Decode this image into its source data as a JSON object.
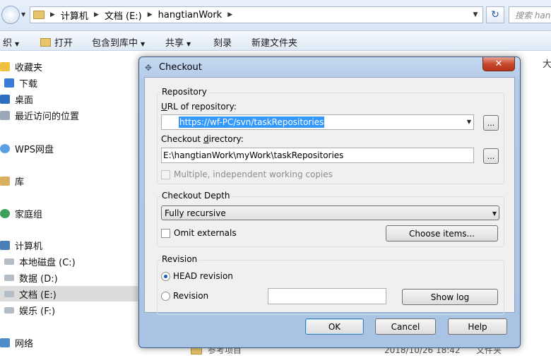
{
  "explorer": {
    "breadcrumb": [
      "计算机",
      "文档 (E:)",
      "hangtianWork"
    ],
    "search_placeholder": "搜索 hang",
    "toolbar": {
      "organize": "织",
      "open": "打开",
      "include_in_library": "包含到库中",
      "share": "共享",
      "burn": "刻录",
      "new_folder": "新建文件夹"
    },
    "sidebar": [
      {
        "label": "收藏夹",
        "icon": "star-icon"
      },
      {
        "label": "下载",
        "icon": "download-folder-icon"
      },
      {
        "label": "桌面",
        "icon": "desktop-icon"
      },
      {
        "label": "最近访问的位置",
        "icon": "recent-places-icon"
      },
      {
        "label": "WPS网盘",
        "icon": "cloud-drive-icon"
      },
      {
        "label": "库",
        "icon": "library-icon"
      },
      {
        "label": "家庭组",
        "icon": "homegroup-icon"
      },
      {
        "label": "计算机",
        "icon": "computer-icon"
      },
      {
        "label": "本地磁盘 (C:)",
        "icon": "drive-icon"
      },
      {
        "label": "数据 (D:)",
        "icon": "drive-icon"
      },
      {
        "label": "文档 (E:)",
        "icon": "drive-icon",
        "selected": true
      },
      {
        "label": "娱乐 (F:)",
        "icon": "drive-icon"
      },
      {
        "label": "网络",
        "icon": "network-icon"
      }
    ],
    "right_edge_text": "大",
    "background_rows": [
      {
        "name": "参考项目",
        "date": "2018/10/26 18:42",
        "type": "文件夹"
      }
    ]
  },
  "dialog": {
    "title": "Checkout",
    "repository": {
      "group_title": "Repository",
      "url_label": "URL of repository:",
      "url_value": "https://wf-PC/svn/taskRepositories",
      "dir_label": "Checkout directory:",
      "dir_value": "E:\\hangtianWork\\myWork\\taskRepositories",
      "browse_label": "...",
      "multiple_label": "Multiple, independent working copies",
      "multiple_checked": false
    },
    "depth": {
      "group_title": "Checkout Depth",
      "selected": "Fully recursive",
      "omit_externals_label": "Omit externals",
      "omit_externals_checked": false,
      "choose_items_label": "Choose items..."
    },
    "revision": {
      "group_title": "Revision",
      "head_label": "HEAD revision",
      "revision_label": "Revision",
      "selected": "head",
      "revision_value": "",
      "show_log_label": "Show log"
    },
    "buttons": {
      "ok": "OK",
      "cancel": "Cancel",
      "help": "Help"
    }
  }
}
